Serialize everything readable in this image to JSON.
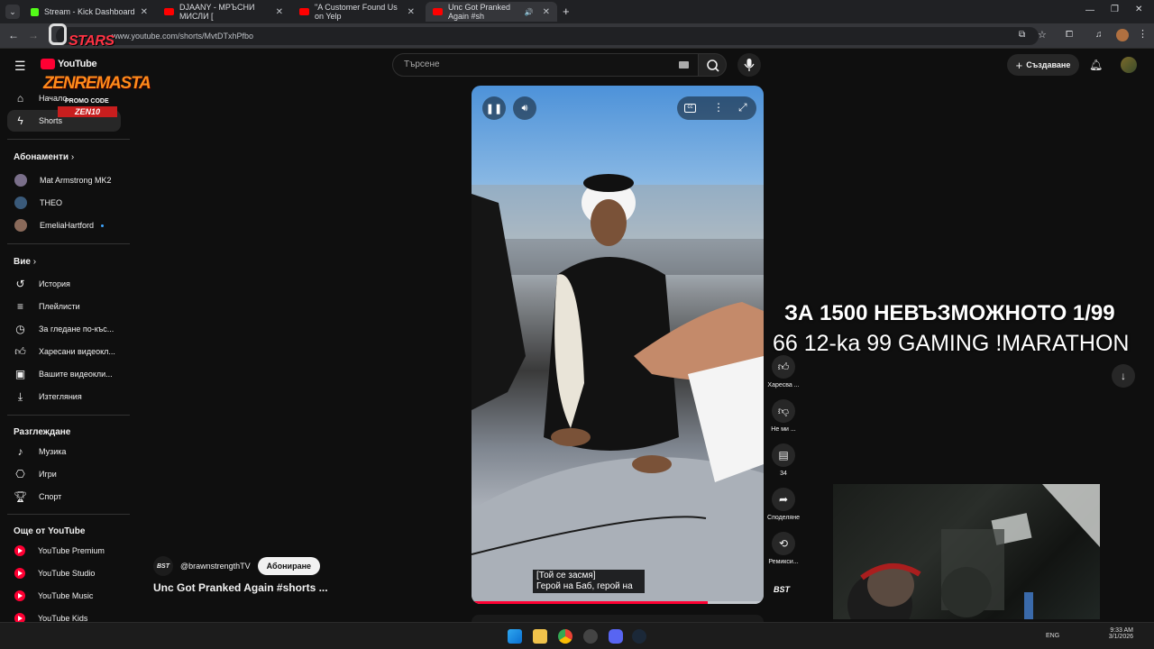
{
  "browser": {
    "tabs": [
      {
        "label": "Stream - Kick Dashboard",
        "type": "kick"
      },
      {
        "label": "DJAANY - МРЪСНИ МИСЛИ [",
        "type": "youtube"
      },
      {
        "label": "\"A Customer Found Us on Yelp",
        "type": "youtube"
      },
      {
        "label": "Unc Got Pranked Again #sh",
        "type": "youtube",
        "active": true
      }
    ],
    "url": "www.youtube.com/shorts/MvtDTxhPfbo"
  },
  "youtube": {
    "logo_text": "YouTube",
    "search_placeholder": "Търсене",
    "create_label": "Създаване",
    "nav_primary": [
      {
        "label": "Начало",
        "icon": "home-icon"
      },
      {
        "label": "Shorts",
        "icon": "shorts-icon",
        "selected": true
      }
    ],
    "subscriptions_header": "Абонаменти",
    "subscriptions": [
      "Mat Armstrong MK2",
      "THEO",
      "EmeliaHartford"
    ],
    "you_header": "Вие",
    "you_items": [
      {
        "label": "История",
        "icon": "history-icon"
      },
      {
        "label": "Плейлисти",
        "icon": "playlist-icon"
      },
      {
        "label": "За гледане по-къс...",
        "icon": "clock-icon"
      },
      {
        "label": "Харесани видеокл...",
        "icon": "thumb-up-icon"
      },
      {
        "label": "Вашите видеокли...",
        "icon": "your-videos-icon"
      },
      {
        "label": "Изтегляния",
        "icon": "download-icon"
      }
    ],
    "explore_header": "Разглеждане",
    "explore_items": [
      {
        "label": "Музика",
        "icon": "music-icon"
      },
      {
        "label": "Игри",
        "icon": "gaming-icon"
      },
      {
        "label": "Спорт",
        "icon": "trophy-icon"
      }
    ],
    "more_header": "Още от YouTube",
    "more_items": [
      "YouTube Premium",
      "YouTube Studio",
      "YouTube Music",
      "YouTube Kids"
    ],
    "short": {
      "subtitle_line1": "[Той се засмя]",
      "subtitle_line2": "Герой на Баб, герой на",
      "channel": "@brawnstrengthTV",
      "subscribe_label": "Абониране",
      "title": "Unc Got Pranked Again #shorts ...",
      "progress": 0.81,
      "actions": [
        {
          "label": "Харесва ...",
          "icon": "thumb-up-icon"
        },
        {
          "label": "Не ми ...",
          "icon": "thumb-down-icon"
        },
        {
          "label": "34",
          "icon": "comment-icon"
        },
        {
          "label": "Споделяне",
          "icon": "share-icon"
        },
        {
          "label": "Ремикси...",
          "icon": "remix-icon"
        }
      ]
    }
  },
  "stream_overlay": {
    "line1": "ЗА 1500 НЕВЪЗМОЖНОТО 1/99",
    "line2": "66 12-ka 99 GAMING !MARATHON",
    "logo_stars": "STARS",
    "logo_brand": "ZENREMASTA",
    "logo_promo": "PROMO CODE",
    "logo_code": "ZEN10"
  },
  "taskbar": {
    "time": "9:33 AM",
    "date": "3/1/2026",
    "lang": "ENG"
  },
  "colors": {
    "accent": "#ff0033",
    "bg": "#0f0f0f"
  }
}
